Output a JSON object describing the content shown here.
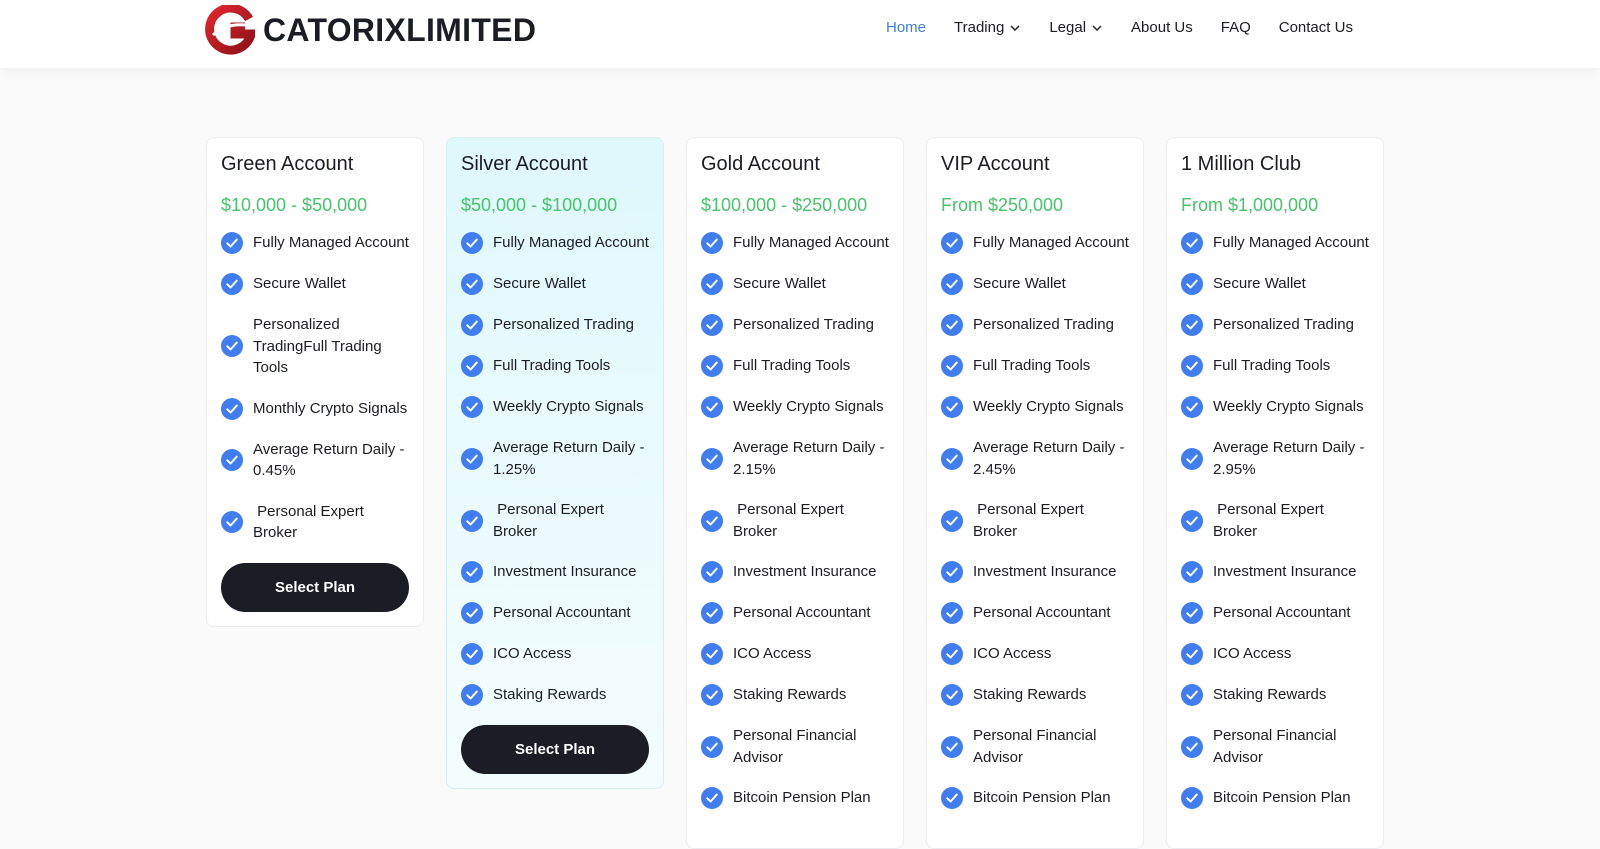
{
  "brand": {
    "name": "CATORIXLIMITED",
    "logo_icon": "g-swoosh-logo",
    "accent": "#e0262e"
  },
  "nav": {
    "items": [
      {
        "label": "Home",
        "active": true,
        "dropdown": false
      },
      {
        "label": "Trading",
        "active": false,
        "dropdown": true
      },
      {
        "label": "Legal",
        "active": false,
        "dropdown": true
      },
      {
        "label": "About Us",
        "active": false,
        "dropdown": false
      },
      {
        "label": "FAQ",
        "active": false,
        "dropdown": false
      },
      {
        "label": "Contact Us",
        "active": false,
        "dropdown": false
      }
    ]
  },
  "colors": {
    "active_link": "#3f7df0",
    "price": "#46c46a",
    "check": "#3f7df0",
    "button": "#1c1d24"
  },
  "plans": [
    {
      "title": "Green Account",
      "price": "$10,000 - $50,000",
      "features": [
        "Fully Managed Account",
        "Secure Wallet",
        "Personalized TradingFull Trading Tools",
        "Monthly Crypto Signals",
        "Average Return Daily - 0.45%",
        " Personal Expert Broker"
      ],
      "button": "Select Plan"
    },
    {
      "title": "Silver Account",
      "price": "$50,000 - $100,000",
      "features": [
        "Fully Managed Account",
        "Secure Wallet",
        "Personalized Trading",
        "Full Trading Tools",
        "Weekly Crypto Signals",
        "Average Return Daily - 1.25%",
        " Personal Expert Broker",
        "Investment Insurance",
        "Personal Accountant",
        "ICO Access",
        "Staking Rewards"
      ],
      "button": "Select Plan"
    },
    {
      "title": "Gold Account",
      "price": "$100,000 - $250,000",
      "features": [
        "Fully Managed Account",
        "Secure Wallet",
        "Personalized Trading",
        "Full Trading Tools",
        "Weekly Crypto Signals",
        "Average Return Daily - 2.15%",
        " Personal Expert Broker",
        "Investment Insurance",
        "Personal Accountant",
        "ICO Access",
        "Staking Rewards",
        "Personal Financial Advisor",
        "Bitcoin Pension Plan"
      ],
      "button": ""
    },
    {
      "title": "VIP Account",
      "price": "From $250,000",
      "features": [
        "Fully Managed Account",
        "Secure Wallet",
        "Personalized Trading",
        "Full Trading Tools",
        "Weekly Crypto Signals",
        "Average Return Daily - 2.45%",
        " Personal Expert Broker",
        "Investment Insurance",
        "Personal Accountant",
        "ICO Access",
        "Staking Rewards",
        "Personal Financial Advisor",
        "Bitcoin Pension Plan"
      ],
      "button": ""
    },
    {
      "title": "1 Million Club",
      "price": "From $1,000,000",
      "features": [
        "Fully Managed Account",
        "Secure Wallet",
        "Personalized Trading",
        "Full Trading Tools",
        "Weekly Crypto Signals",
        "Average Return Daily - 2.95%",
        " Personal Expert Broker",
        "Investment Insurance",
        "Personal Accountant",
        "ICO Access",
        "Staking Rewards",
        "Personal Financial Advisor",
        "Bitcoin Pension Plan"
      ],
      "button": ""
    }
  ]
}
